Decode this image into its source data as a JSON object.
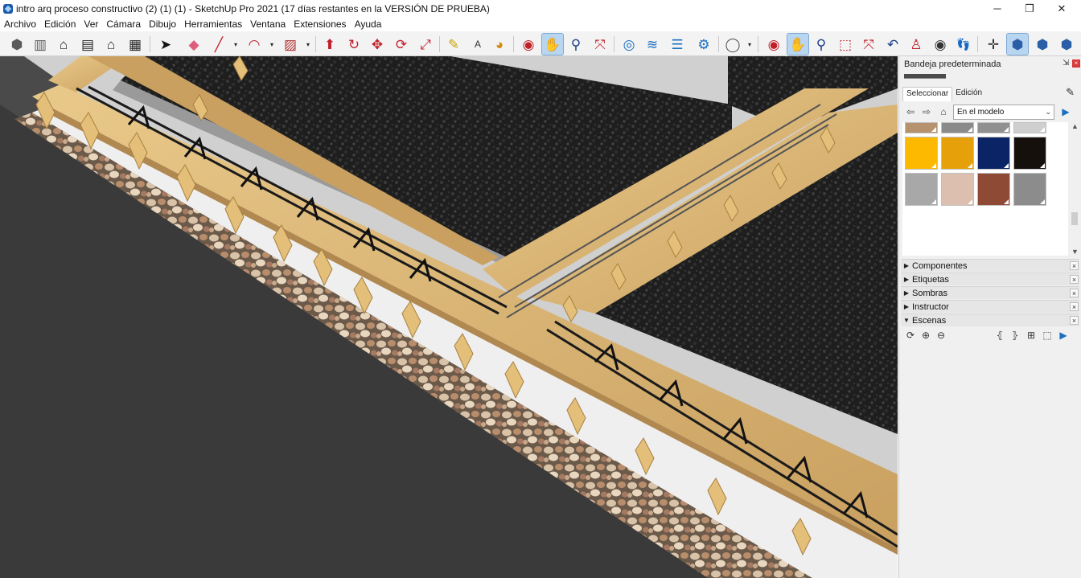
{
  "window": {
    "title": "intro arq proceso constructivo (2) (1) (1) - SketchUp Pro 2021 (17 días restantes en la VERSIÓN DE PRUEBA)",
    "minimize": "─",
    "maximize": "❐",
    "close": "✕"
  },
  "menu": [
    "Archivo",
    "Edición",
    "Ver",
    "Cámara",
    "Dibujo",
    "Herramientas",
    "Ventana",
    "Extensiones",
    "Ayuda"
  ],
  "toolbar": {
    "icons": [
      {
        "name": "iso-view-icon",
        "glyph": "⬢"
      },
      {
        "name": "top-view-icon",
        "glyph": "▥"
      },
      {
        "name": "home-view-icon",
        "glyph": "⌂"
      },
      {
        "name": "front-view-icon",
        "glyph": "▤"
      },
      {
        "name": "right-view-icon",
        "glyph": "⌂"
      },
      {
        "name": "back-view-icon",
        "glyph": "▦"
      },
      {
        "name": "select-tool-icon",
        "glyph": "➤"
      },
      {
        "name": "eraser-tool-icon",
        "glyph": "◆"
      },
      {
        "name": "line-tool-icon",
        "glyph": "╱"
      },
      {
        "name": "arc-tool-icon",
        "glyph": "◠"
      },
      {
        "name": "rectangle-tool-icon",
        "glyph": "▨"
      },
      {
        "name": "push-pull-tool-icon",
        "glyph": "⬆"
      },
      {
        "name": "follow-me-tool-icon",
        "glyph": "↻"
      },
      {
        "name": "move-tool-icon",
        "glyph": "✥"
      },
      {
        "name": "rotate-tool-icon",
        "glyph": "⟳"
      },
      {
        "name": "scale-tool-icon",
        "glyph": "⤢"
      },
      {
        "name": "tape-measure-icon",
        "glyph": "✎"
      },
      {
        "name": "text-tool-icon",
        "glyph": "A"
      },
      {
        "name": "paint-bucket-icon",
        "glyph": "◕"
      },
      {
        "name": "orbit-tool-icon",
        "glyph": "◉"
      },
      {
        "name": "pan-tool-icon",
        "glyph": "✋"
      },
      {
        "name": "zoom-tool-icon",
        "glyph": "⚲"
      },
      {
        "name": "zoom-extents-icon",
        "glyph": "⤧"
      },
      {
        "name": "warehouse-icon",
        "glyph": "◎"
      },
      {
        "name": "extension-warehouse-icon",
        "glyph": "≋"
      },
      {
        "name": "layout-icon",
        "glyph": "☰"
      },
      {
        "name": "extension-manager-icon",
        "glyph": "⚙"
      },
      {
        "name": "user-account-icon",
        "glyph": "◯"
      },
      {
        "name": "orbit-tool-2-icon",
        "glyph": "◉"
      },
      {
        "name": "pan-tool-2-icon",
        "glyph": "✋"
      },
      {
        "name": "zoom-tool-2-icon",
        "glyph": "⚲"
      },
      {
        "name": "zoom-window-icon",
        "glyph": "⬚"
      },
      {
        "name": "zoom-extents-2-icon",
        "glyph": "⤧"
      },
      {
        "name": "previous-view-icon",
        "glyph": "↶"
      },
      {
        "name": "position-camera-icon",
        "glyph": "♙"
      },
      {
        "name": "look-around-icon",
        "glyph": "◉"
      },
      {
        "name": "walk-icon",
        "glyph": "👣"
      },
      {
        "name": "axes-icon",
        "glyph": "✛"
      },
      {
        "name": "xray-style-icon",
        "glyph": "⬢"
      },
      {
        "name": "wireframe-style-icon",
        "glyph": "⬢"
      },
      {
        "name": "shaded-style-icon",
        "glyph": "⬢"
      }
    ],
    "dropdown": "▾"
  },
  "tray": {
    "title": "Bandeja predeterminada",
    "pin": "⇲",
    "close": "×",
    "tabs": [
      "Seleccionar",
      "Edición"
    ],
    "collection": "En el modelo",
    "nav": {
      "back": "⇦",
      "forward": "⇨",
      "home": "⌂",
      "details": "▶"
    },
    "swatch_colors": [
      "#b7926e",
      "#8a8a8a",
      "#909090",
      "#cfcfcf",
      "#fcb900",
      "#e6a10a",
      "#0a2466",
      "#15100c",
      "#a8a8a8",
      "#dcbfae",
      "#8f4a36",
      "#8c8c8c"
    ],
    "sections": [
      {
        "label": "Componentes",
        "expanded": false
      },
      {
        "label": "Etiquetas",
        "expanded": false
      },
      {
        "label": "Sombras",
        "expanded": false
      },
      {
        "label": "Instructor",
        "expanded": false
      },
      {
        "label": "Escenas",
        "expanded": true
      }
    ],
    "collapsed_arrow": "▶",
    "expanded_arrow": "▼",
    "scene_tools": [
      "⟳",
      "⊕",
      "⊖",
      "⦃",
      "⦄",
      "⊞",
      "⬚",
      "▶"
    ]
  }
}
